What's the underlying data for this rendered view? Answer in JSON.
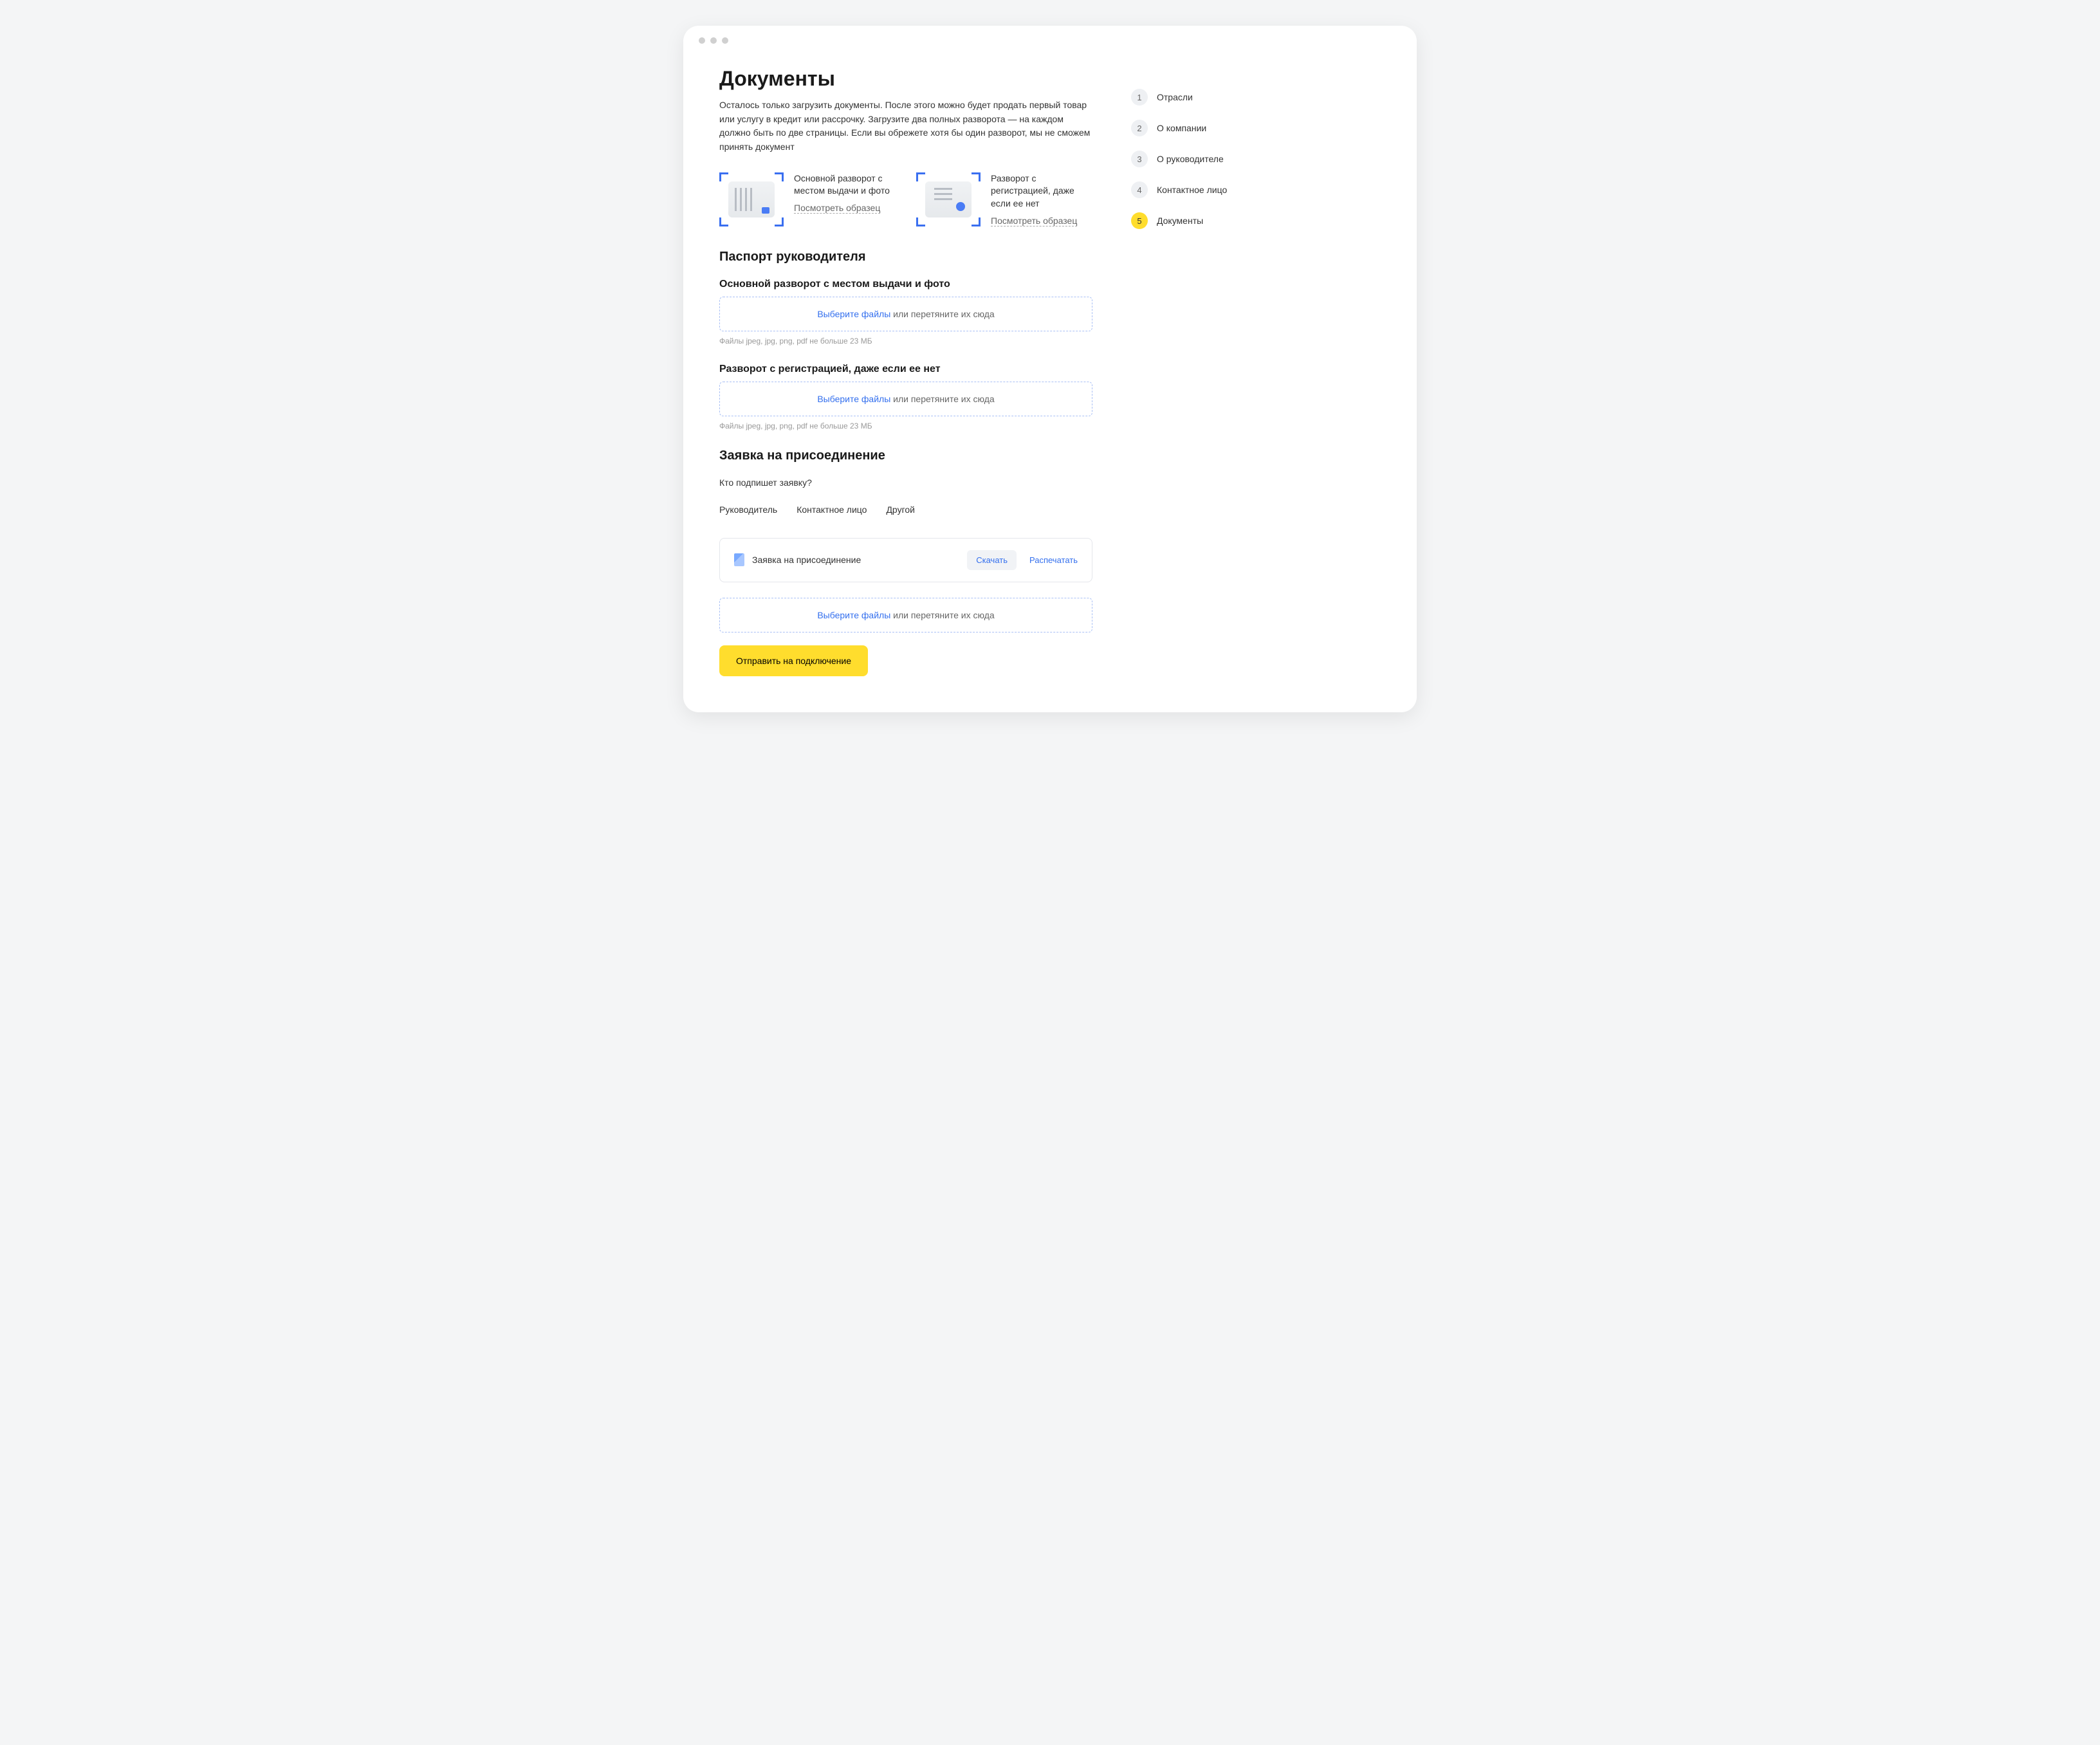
{
  "page": {
    "title": "Документы",
    "intro": "Осталось только загрузить документы. После этого можно будет продать первый товар или услугу в кредит или рассрочку. Загрузите два полных разворота — на каждом должно быть по две страницы. Если вы обрежете хотя бы один разворот, мы не сможем принять документ"
  },
  "examples": {
    "main": {
      "label": "Основной разворот с местом выдачи и фото",
      "link": "Посмотреть образец"
    },
    "registration": {
      "label": "Разворот с регистрацией, даже если ее нет",
      "link": "Посмотреть образец"
    }
  },
  "passport": {
    "heading": "Паспорт руководителя",
    "upload1_title": "Основной разворот с местом выдачи и фото",
    "upload2_title": "Разворот с регистрацией, даже если ее нет",
    "select_label": "Выберите файлы",
    "drag_label": " или перетяните их сюда",
    "hint": "Файлы jpeg, jpg, png, pdf не больше 23 МБ"
  },
  "application": {
    "heading": "Заявка на присоединение",
    "signer_question": "Кто подпишет заявку?",
    "tabs": [
      "Руководитель",
      "Контактное лицо",
      "Другой"
    ],
    "doc_name": "Заявка на присоединение",
    "download": "Скачать",
    "print": "Распечатать"
  },
  "submit_label": "Отправить на подключение",
  "steps": [
    {
      "num": "1",
      "label": "Отрасли"
    },
    {
      "num": "2",
      "label": "О компании"
    },
    {
      "num": "3",
      "label": "О руководителе"
    },
    {
      "num": "4",
      "label": "Контактное лицо"
    },
    {
      "num": "5",
      "label": "Документы"
    }
  ],
  "active_step": 4
}
